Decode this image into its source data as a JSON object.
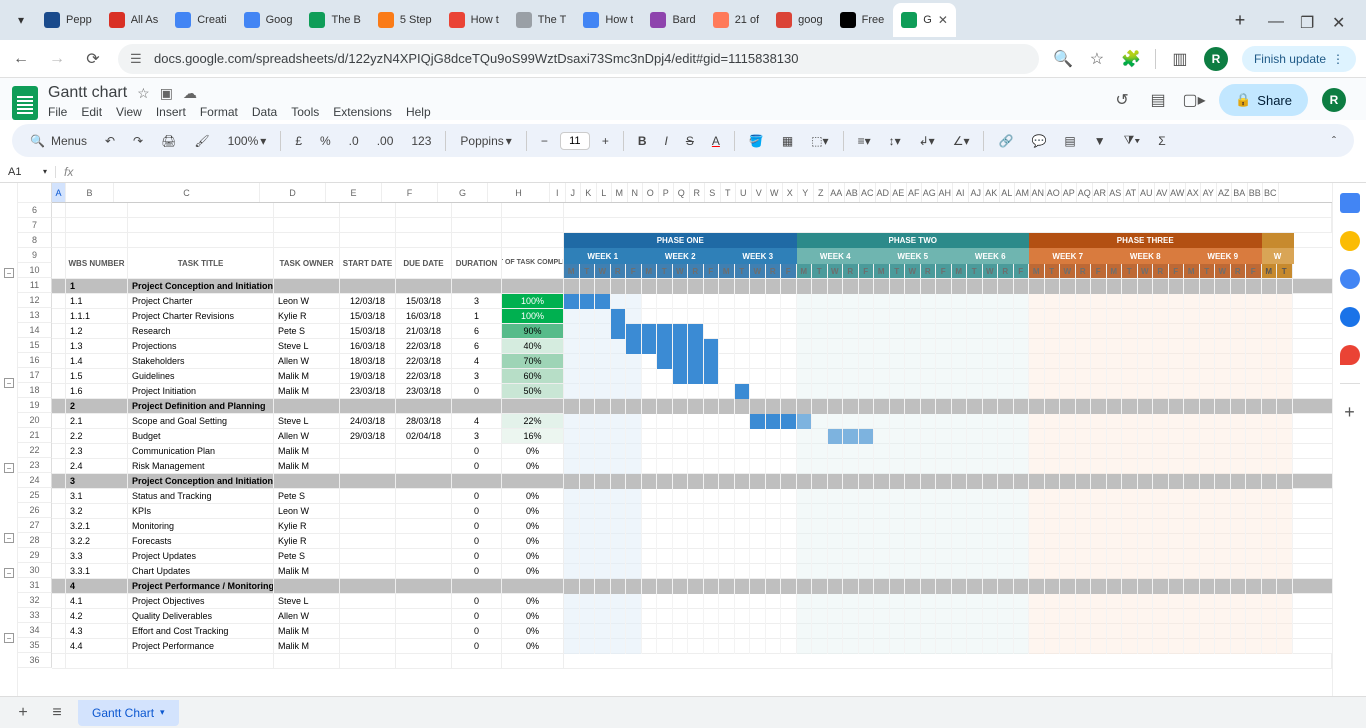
{
  "browser": {
    "tabs": [
      {
        "title": "Pepp",
        "color": "#1a4b8c"
      },
      {
        "title": "All As",
        "color": "#d93025"
      },
      {
        "title": "Creati",
        "color": "#4285f4"
      },
      {
        "title": "Goog",
        "color": "#4285f4"
      },
      {
        "title": "The B",
        "color": "#0f9d58"
      },
      {
        "title": "5 Step",
        "color": "#fa7b17"
      },
      {
        "title": "How t",
        "color": "#ea4335"
      },
      {
        "title": "The T",
        "color": "#9aa0a6"
      },
      {
        "title": "How t",
        "color": "#4285f4"
      },
      {
        "title": "Bard",
        "color": "#8e44ad"
      },
      {
        "title": "21 of",
        "color": "#ff7a59"
      },
      {
        "title": "goog",
        "color": "#db4437"
      },
      {
        "title": "Free",
        "color": "#000"
      },
      {
        "title": "G",
        "color": "#0f9d58",
        "active": true
      }
    ],
    "url": "docs.google.com/spreadsheets/d/122yzN4XPIQjG8dceTQu9oS99WztDsaxi73Smc3nDpj4/edit#gid=1115838130",
    "profile_letter": "R",
    "finish_update": "Finish update"
  },
  "sheets": {
    "doc_title": "Gantt chart",
    "menus": [
      "File",
      "Edit",
      "View",
      "Insert",
      "Format",
      "Data",
      "Tools",
      "Extensions",
      "Help"
    ],
    "toolbar": {
      "menus_label": "Menus",
      "zoom": "100%",
      "font": "Poppins",
      "font_size": "11"
    },
    "cell_ref": "A1",
    "share_label": "Share",
    "sheet_tab": "Gantt Chart"
  },
  "columns": {
    "letters_task": [
      "A",
      "B",
      "C",
      "D",
      "E",
      "F",
      "G",
      "H"
    ],
    "letters_days": [
      "I",
      "J",
      "K",
      "L",
      "M",
      "N",
      "O",
      "P",
      "Q",
      "R",
      "S",
      "T",
      "U",
      "V",
      "W",
      "X",
      "Y",
      "Z",
      "AA",
      "AB",
      "AC",
      "AD",
      "AE",
      "AF",
      "AG",
      "AH",
      "AI",
      "AJ",
      "AK",
      "AL",
      "AM",
      "AN",
      "AO",
      "AP",
      "AQ",
      "AR",
      "AS",
      "AT",
      "AU",
      "AV",
      "AW",
      "AX",
      "AY",
      "AZ",
      "BA",
      "BB",
      "BC"
    ],
    "headers": {
      "wbs": "WBS NUMBER",
      "title": "TASK TITLE",
      "owner": "TASK OWNER",
      "start": "START DATE",
      "due": "DUE DATE",
      "dur": "DURATION",
      "pct": "PCT OF TASK COMPLETE"
    }
  },
  "phases": [
    {
      "name": "PHASE ONE",
      "color": "#1f6aa5",
      "weeks": [
        {
          "name": "WEEK 1",
          "color": "#2f80b8"
        },
        {
          "name": "WEEK 2",
          "color": "#2f80b8"
        },
        {
          "name": "WEEK 3",
          "color": "#2f80b8"
        }
      ]
    },
    {
      "name": "PHASE TWO",
      "color": "#2c8a8a",
      "weeks": [
        {
          "name": "WEEK 4",
          "color": "#6fb5b0"
        },
        {
          "name": "WEEK 5",
          "color": "#6fb5b0"
        },
        {
          "name": "WEEK 6",
          "color": "#6fb5b0"
        }
      ]
    },
    {
      "name": "PHASE THREE",
      "color": "#b35012",
      "weeks": [
        {
          "name": "WEEK 7",
          "color": "#d97b3e"
        },
        {
          "name": "WEEK 8",
          "color": "#d97b3e"
        },
        {
          "name": "WEEK 9",
          "color": "#d97b3e"
        }
      ]
    }
  ],
  "day_labels": [
    "M",
    "T",
    "W",
    "R",
    "F"
  ],
  "row_start": 6,
  "tasks": [
    {
      "type": "section",
      "wbs": "1",
      "title": "Project Conception and Initiation"
    },
    {
      "wbs": "1.1",
      "title": "Project Charter",
      "owner": "Leon W",
      "start": "12/03/18",
      "due": "15/03/18",
      "dur": "3",
      "pct": "100%",
      "pcls": "pct-100",
      "bar": [
        0,
        3
      ]
    },
    {
      "wbs": "1.1.1",
      "title": "Project Charter Revisions",
      "owner": "Kylie R",
      "start": "15/03/18",
      "due": "16/03/18",
      "dur": "1",
      "pct": "100%",
      "pcls": "pct-100",
      "bar": [
        3,
        4
      ]
    },
    {
      "wbs": "1.2",
      "title": "Research",
      "owner": "Pete S",
      "start": "15/03/18",
      "due": "21/03/18",
      "dur": "6",
      "pct": "90%",
      "pcls": "pct-90",
      "bar": [
        3,
        9
      ]
    },
    {
      "wbs": "1.3",
      "title": "Projections",
      "owner": "Steve L",
      "start": "16/03/18",
      "due": "22/03/18",
      "dur": "6",
      "pct": "40%",
      "pcls": "pct-40",
      "bar": [
        4,
        10
      ]
    },
    {
      "wbs": "1.4",
      "title": "Stakeholders",
      "owner": "Allen W",
      "start": "18/03/18",
      "due": "22/03/18",
      "dur": "4",
      "pct": "70%",
      "pcls": "pct-70",
      "bar": [
        6,
        10
      ]
    },
    {
      "wbs": "1.5",
      "title": "Guidelines",
      "owner": "Malik M",
      "start": "19/03/18",
      "due": "22/03/18",
      "dur": "3",
      "pct": "60%",
      "pcls": "pct-60",
      "bar": [
        7,
        10
      ]
    },
    {
      "wbs": "1.6",
      "title": "Project Initiation",
      "owner": "Malik M",
      "start": "23/03/18",
      "due": "23/03/18",
      "dur": "0",
      "pct": "50%",
      "pcls": "pct-50",
      "bar": [
        11,
        12
      ]
    },
    {
      "type": "section",
      "wbs": "2",
      "title": "Project Definition and Planning"
    },
    {
      "wbs": "2.1",
      "title": "Scope and Goal Setting",
      "owner": "Steve L",
      "start": "24/03/18",
      "due": "28/03/18",
      "dur": "4",
      "pct": "22%",
      "pcls": "pct-22",
      "bar": [
        12,
        16
      ]
    },
    {
      "wbs": "2.2",
      "title": "Budget",
      "owner": "Allen W",
      "start": "29/03/18",
      "due": "02/04/18",
      "dur": "3",
      "pct": "16%",
      "pcls": "pct-16",
      "bar": [
        17,
        20
      ]
    },
    {
      "wbs": "2.3",
      "title": "Communication Plan",
      "owner": "Malik M",
      "start": "",
      "due": "",
      "dur": "0",
      "pct": "0%",
      "pcls": "pct-0"
    },
    {
      "wbs": "2.4",
      "title": "Risk Management",
      "owner": "Malik M",
      "start": "",
      "due": "",
      "dur": "0",
      "pct": "0%",
      "pcls": "pct-0"
    },
    {
      "type": "section",
      "wbs": "3",
      "title": "Project Conception and Initiation"
    },
    {
      "wbs": "3.1",
      "title": "Status and Tracking",
      "owner": "Pete S",
      "start": "",
      "due": "",
      "dur": "0",
      "pct": "0%",
      "pcls": "pct-0"
    },
    {
      "wbs": "3.2",
      "title": "KPIs",
      "owner": "Leon W",
      "start": "",
      "due": "",
      "dur": "0",
      "pct": "0%",
      "pcls": "pct-0"
    },
    {
      "wbs": "3.2.1",
      "title": "Monitoring",
      "owner": "Kylie R",
      "start": "",
      "due": "",
      "dur": "0",
      "pct": "0%",
      "pcls": "pct-0"
    },
    {
      "wbs": "3.2.2",
      "title": "Forecasts",
      "owner": "Kylie R",
      "start": "",
      "due": "",
      "dur": "0",
      "pct": "0%",
      "pcls": "pct-0"
    },
    {
      "wbs": "3.3",
      "title": "Project Updates",
      "owner": "Pete S",
      "start": "",
      "due": "",
      "dur": "0",
      "pct": "0%",
      "pcls": "pct-0"
    },
    {
      "wbs": "3.3.1",
      "title": "Chart Updates",
      "owner": "Malik M",
      "start": "",
      "due": "",
      "dur": "0",
      "pct": "0%",
      "pcls": "pct-0"
    },
    {
      "type": "section",
      "wbs": "4",
      "title": "Project Performance / Monitoring"
    },
    {
      "wbs": "4.1",
      "title": "Project Objectives",
      "owner": "Steve L",
      "start": "",
      "due": "",
      "dur": "0",
      "pct": "0%",
      "pcls": "pct-0"
    },
    {
      "wbs": "4.2",
      "title": "Quality Deliverables",
      "owner": "Allen W",
      "start": "",
      "due": "",
      "dur": "0",
      "pct": "0%",
      "pcls": "pct-0"
    },
    {
      "wbs": "4.3",
      "title": "Effort and Cost Tracking",
      "owner": "Malik M",
      "start": "",
      "due": "",
      "dur": "0",
      "pct": "0%",
      "pcls": "pct-0"
    },
    {
      "wbs": "4.4",
      "title": "Project Performance",
      "owner": "Malik M",
      "start": "",
      "due": "",
      "dur": "0",
      "pct": "0%",
      "pcls": "pct-0"
    }
  ]
}
